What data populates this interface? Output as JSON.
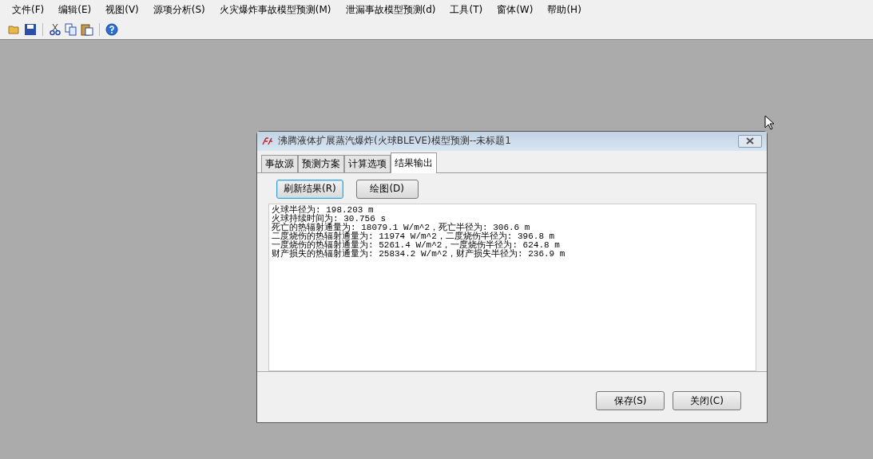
{
  "menu": [
    "文件(F)",
    "编辑(E)",
    "视图(V)",
    "源项分析(S)",
    "火灾爆炸事故模型预测(M)",
    "泄漏事故模型预测(d)",
    "工具(T)",
    "窗体(W)",
    "帮助(H)"
  ],
  "toolbar": [
    {
      "kind": "open"
    },
    {
      "kind": "save"
    },
    {
      "kind": "sep"
    },
    {
      "kind": "cut"
    },
    {
      "kind": "copy"
    },
    {
      "kind": "paste"
    },
    {
      "kind": "sep"
    },
    {
      "kind": "help"
    }
  ],
  "dialog": {
    "title": "沸腾液体扩展蒸汽爆炸(火球BLEVE)模型预测--未标题1",
    "tabs": [
      {
        "label": "事故源",
        "selected": false
      },
      {
        "label": "预测方案",
        "selected": false
      },
      {
        "label": "计算选项",
        "selected": false
      },
      {
        "label": "结果输出",
        "selected": true
      }
    ],
    "actions": [
      {
        "label": "刷新结果(R)",
        "focused": true
      },
      {
        "label": "绘图(D)",
        "focused": false
      }
    ],
    "output_lines": [
      "火球半径为: 198.203 m",
      "火球持续时间为: 30.756 s",
      "死亡的热辐射通量为: 18079.1 W/m^2，死亡半径为: 306.6 m",
      "二度烧伤的热辐射通量为: 11974 W/m^2，二度烧伤半径为: 396.8 m",
      "一度烧伤的热辐射通量为: 5261.4 W/m^2，一度烧伤半径为: 624.8 m",
      "财产损失的热辐射通量为: 25834.2 W/m^2，财产损失半径为: 236.9 m"
    ],
    "buttons": [
      "保存(S)",
      "关闭(C)"
    ]
  }
}
